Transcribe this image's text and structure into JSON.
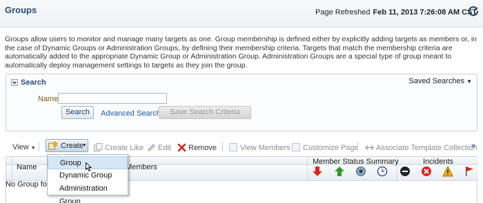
{
  "header": {
    "title": "Groups",
    "refresh_label": "Page Refreshed",
    "refresh_value": "Feb 11, 2013 7:26:08 AM CST",
    "refresh_icon": "refresh-icon"
  },
  "description": "Groups allow users to monitor and manage many targets as one. Group membership is defined either by explicitly adding targets as members or, in the case of Dynamic Groups or Administration Groups, by defining their membership criteria. Targets that match the membership criteria are automatically added to the appropriate Dynamic Group or Administration Group. Administration Groups are a special type of group meant to automatically deploy management settings to targets as they join the group.",
  "search": {
    "title": "Search",
    "saved_searches": "Saved Searches",
    "name_label": "Name",
    "name_value": "",
    "search_button": "Search",
    "advanced_link": "Advanced Search",
    "save_button": "Save Search Criteria"
  },
  "toolbar": {
    "view": "View",
    "create": "Create",
    "create_like": "Create Like",
    "edit": "Edit",
    "remove": "Remove",
    "view_members": "View Members",
    "customize_page": "Customize Page",
    "associate_template": "Associate Template Collection",
    "more": "»"
  },
  "table": {
    "columns": [
      "Name",
      "Members"
    ],
    "group_headers": [
      "Member Status Summary",
      "Incidents"
    ],
    "status_icons": [
      "down-arrow-icon",
      "up-arrow-icon",
      "unknown-status-icon",
      "clock-icon",
      "minus-icon",
      "critical-icon",
      "warning-icon",
      "flag-icon"
    ],
    "empty_message": "No Group fou"
  },
  "create_menu": {
    "items": [
      "Group",
      "Dynamic Group",
      "Administration Group"
    ],
    "highlighted": "Group"
  },
  "colors": {
    "title": "#2a4b73",
    "link": "#1d55a4",
    "highlight": "#d7e6f6",
    "down": "#d9251d",
    "up": "#2f9a2a",
    "warning": "#f2b400"
  }
}
